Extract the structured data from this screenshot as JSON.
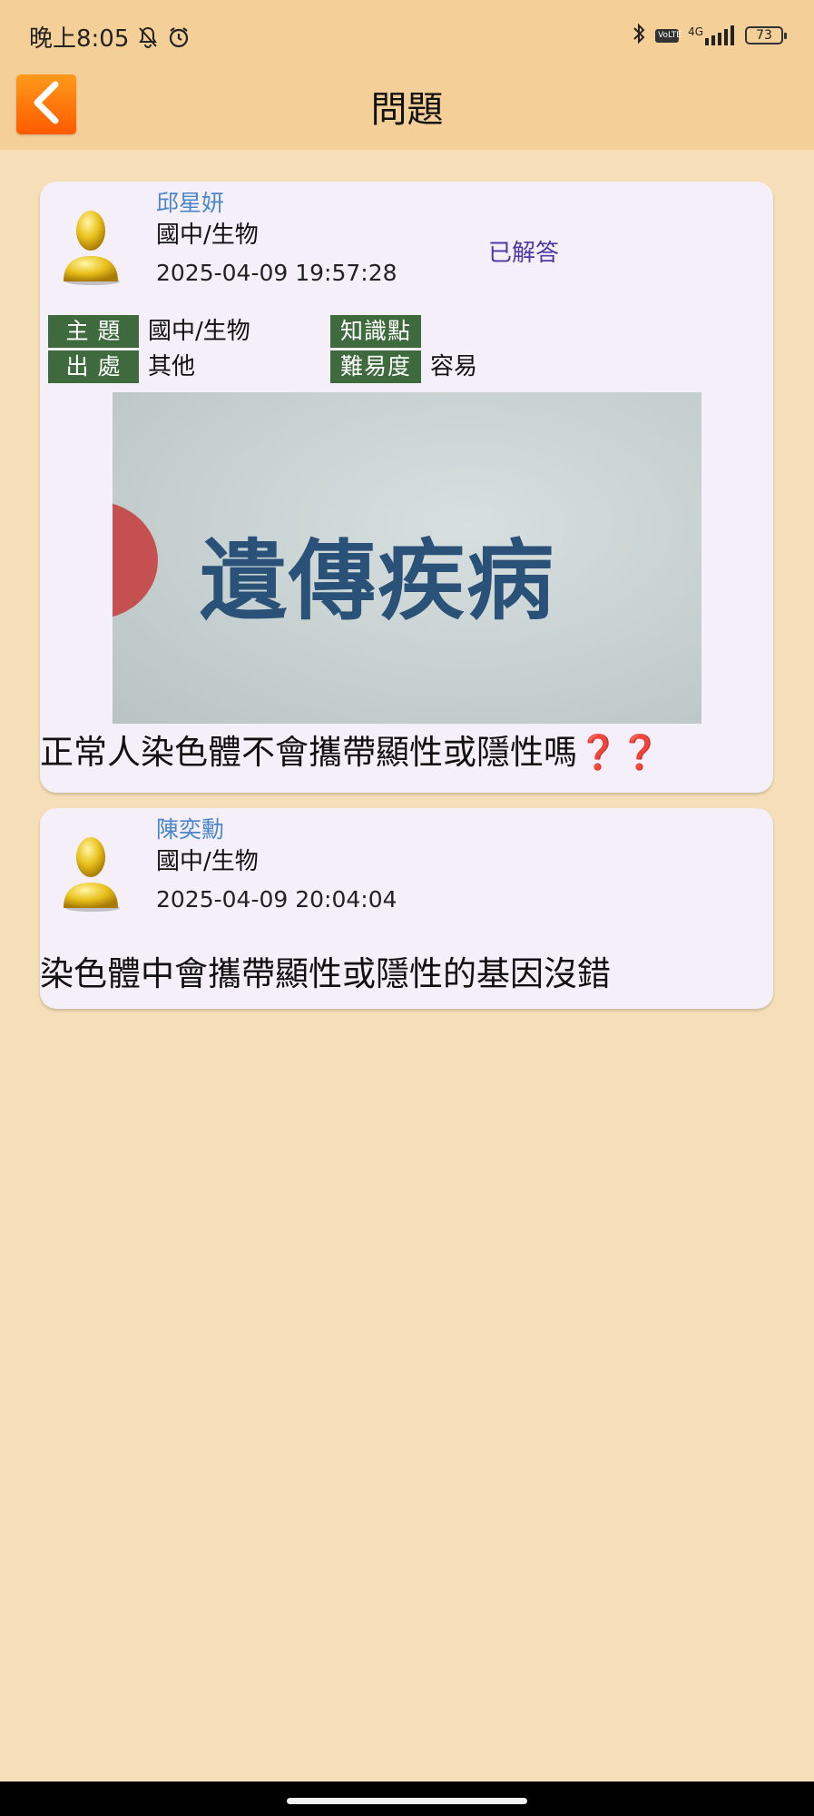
{
  "status_bar": {
    "time": "晚上8:05",
    "network": "4G",
    "volte": "VoLTE",
    "battery": "73"
  },
  "header": {
    "title": "問題"
  },
  "colors": {
    "header_bg": "#f5cf98",
    "page_bg": "#f6dfb8",
    "tag_bg": "#3f6a3e",
    "accent_name": "#4a86c9",
    "status_answered": "#4b3aa3"
  },
  "question": {
    "author": "邱星妍",
    "subject": "國中/生物",
    "timestamp": "2025-04-09 19:57:28",
    "status": "已解答",
    "meta": {
      "topic_label": "主 題",
      "topic_value": "國中/生物",
      "knowledge_label": "知識點",
      "knowledge_value": "",
      "source_label": "出 處",
      "source_value": "其他",
      "difficulty_label": "難易度",
      "difficulty_value": "容易"
    },
    "image_text": "遺傳疾病",
    "content": "正常人染色體不會攜帶顯性或隱性嗎",
    "content_emoji": "❓❓"
  },
  "reply": {
    "author": "陳奕勳",
    "subject": "國中/生物",
    "timestamp": "2025-04-09 20:04:04",
    "content": "染色體中會攜帶顯性或隱性的基因沒錯"
  }
}
